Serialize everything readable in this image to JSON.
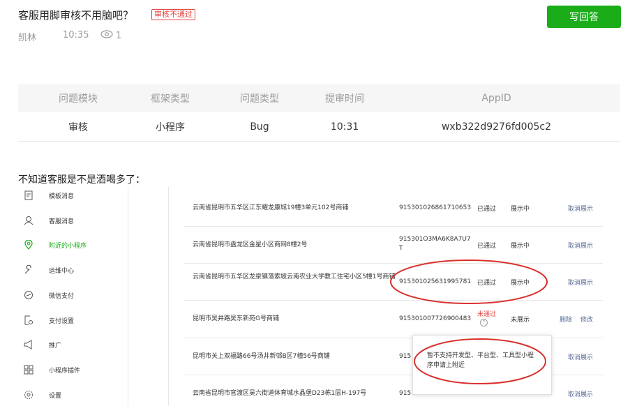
{
  "question": {
    "title": "客服用脚审核不用脑吧？",
    "badge": "审核不通过",
    "answer_button": "写回答",
    "author": "凯林",
    "time": "10:35",
    "views": "1"
  },
  "info_table": {
    "headers": [
      "问题模块",
      "框架类型",
      "问题类型",
      "提审时间",
      "AppID"
    ],
    "row": [
      "审核",
      "小程序",
      "Bug",
      "10:31",
      "wxb322d9276fd005c2"
    ]
  },
  "comment": "不知道客服是不是酒喝多了：",
  "screenshot": {
    "sidebar": [
      {
        "label": "模板消息",
        "icon": "template-icon"
      },
      {
        "label": "客服消息",
        "icon": "user-icon"
      },
      {
        "label": "附近的小程序",
        "icon": "location-icon"
      },
      {
        "label": "运维中心",
        "icon": "wrench-icon"
      },
      {
        "label": "微信支付",
        "icon": "pay-icon"
      },
      {
        "label": "支付设置",
        "icon": "doc-settings-icon"
      },
      {
        "label": "推广",
        "icon": "megaphone-icon"
      },
      {
        "label": "小程序插件",
        "icon": "plugin-icon"
      },
      {
        "label": "设置",
        "icon": "gear-icon"
      }
    ],
    "rows": [
      {
        "address": "云南省昆明市五华区江东耀龙康城19幢3单元102号商铺",
        "reg": "915301026861710653",
        "status": "已通过",
        "show": "展示中",
        "action": "取消展示"
      },
      {
        "address": "云南省昆明市盘龙区金星小区商网8幢2号",
        "reg": "915301O3MA6K8A7U7T",
        "status": "已通过",
        "show": "展示中",
        "action": "取消展示"
      },
      {
        "address": "云南省昆明市五华区龙泉镇落索坡云南农业大学教工住宅小区5幢1号商铺",
        "reg": "915301025631995781",
        "status": "已通过",
        "show": "展示中",
        "action": "取消展示"
      },
      {
        "address": "昆明市吴井路吴东新苑G号商铺",
        "reg": "915301007726900483",
        "status": "未通过",
        "show": "未展示",
        "action": "修改",
        "action2": "删除"
      },
      {
        "address": "昆明市关上双福路66号汤井新邨B区7幢56号商铺",
        "reg": "915",
        "status": "",
        "show": "",
        "action": "取消展示"
      },
      {
        "address": "云南省昆明市官渡区吴六街道体育城水晶堡D23栋1层H-197号",
        "reg": "915",
        "status": "",
        "show": "",
        "action": "取消展示"
      }
    ],
    "tooltip": "暂不支持开发型、平台型、工具型小程序申请上附近",
    "colors": {
      "green": "#1aad19",
      "red": "#e64340",
      "link": "#576b95",
      "circle": "#d9302c"
    }
  }
}
